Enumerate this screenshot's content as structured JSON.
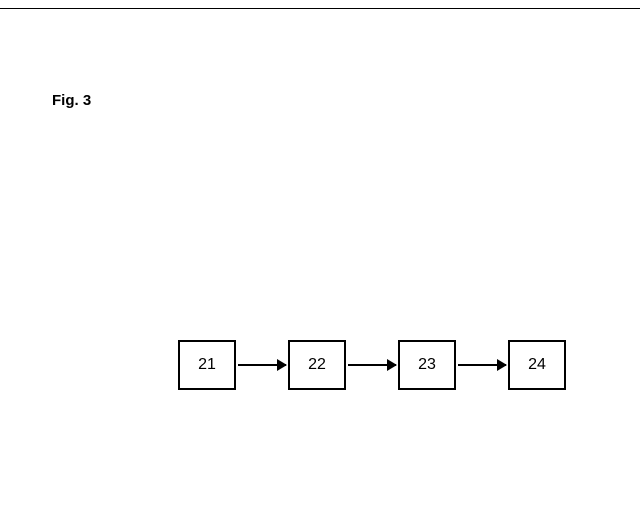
{
  "figure_label": "Fig. 3",
  "flow": {
    "boxes": [
      {
        "label": "21"
      },
      {
        "label": "22"
      },
      {
        "label": "23"
      },
      {
        "label": "24"
      }
    ]
  }
}
